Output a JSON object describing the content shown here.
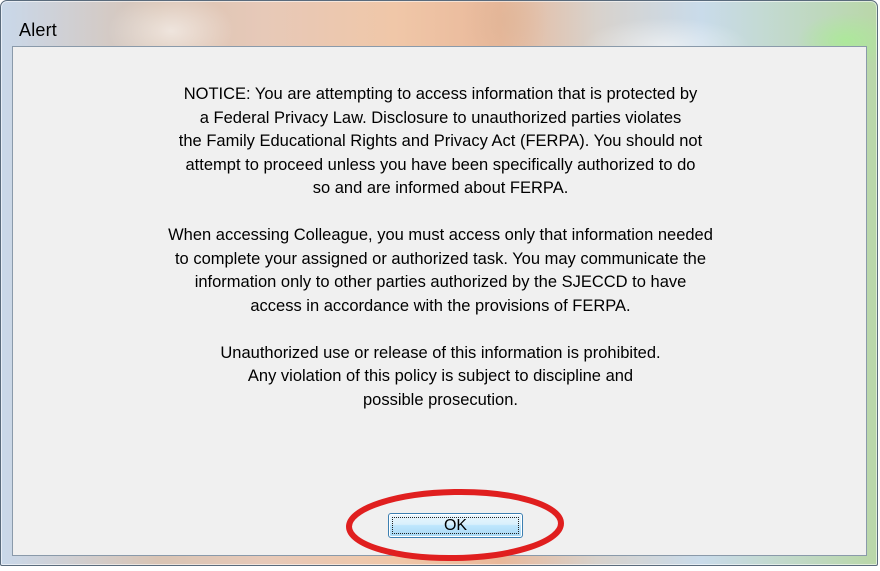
{
  "window": {
    "title": "Alert"
  },
  "message": {
    "paragraph1": "NOTICE:  You are attempting to access information that is protected by\na Federal Privacy Law.  Disclosure to unauthorized parties violates\nthe Family Educational Rights and Privacy Act (FERPA).  You should not\nattempt to proceed unless you have been specifically authorized to do\nso and are informed about FERPA.",
    "paragraph2": "When accessing Colleague, you must access only that information needed\nto complete your assigned or authorized task.  You may communicate the\ninformation only to other parties authorized by the SJECCD to have\naccess in accordance with the provisions of FERPA.",
    "paragraph3": "Unauthorized use or release of this information is prohibited.\nAny violation of this policy is subject to discipline and\npossible prosecution."
  },
  "buttons": {
    "ok_label": "OK"
  },
  "colors": {
    "dialog_background": "#f0f0f0",
    "button_border": "#3c7fb1",
    "highlight_ring": "#e01f1f"
  }
}
